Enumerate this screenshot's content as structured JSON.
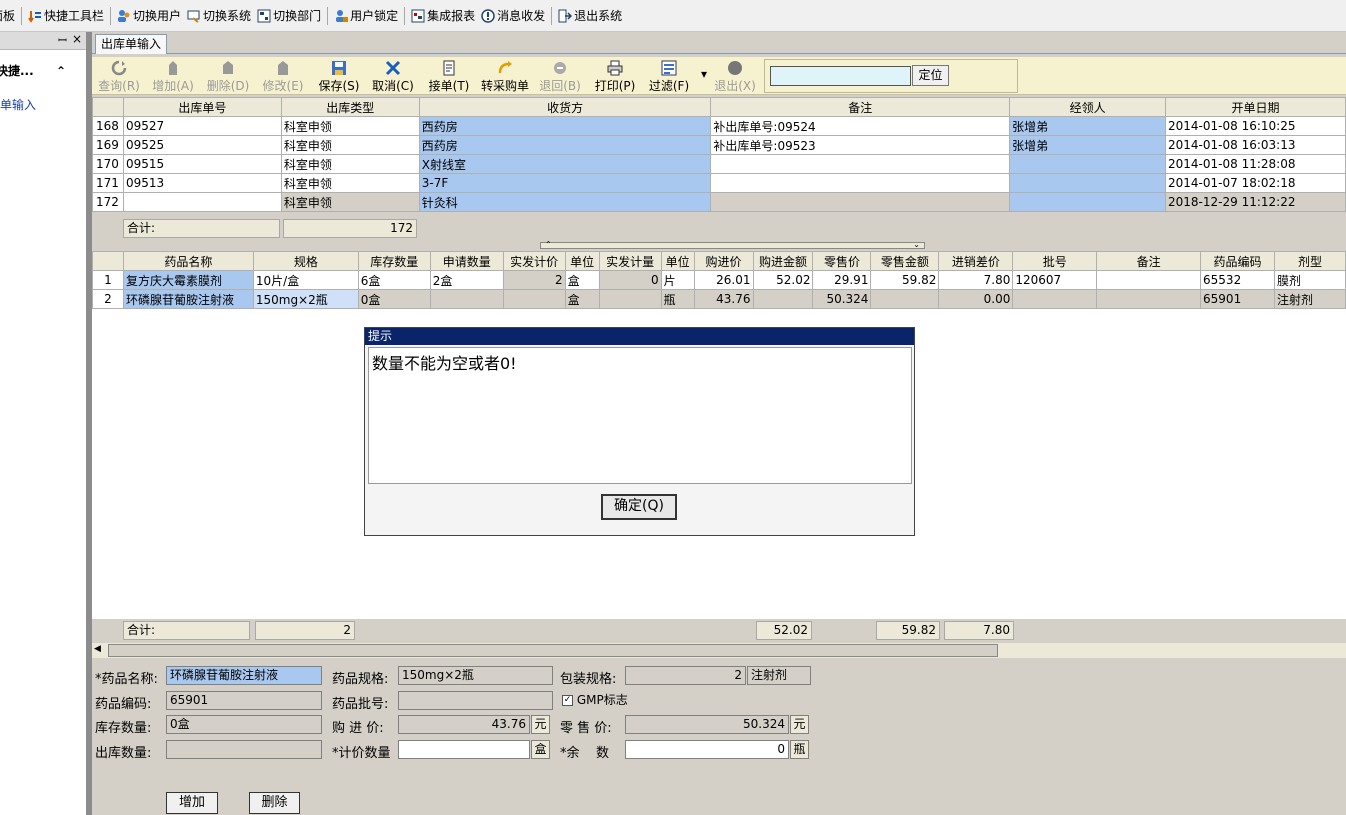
{
  "topbar": {
    "items": [
      {
        "label": "面板",
        "icon": "panel-icon"
      },
      {
        "label": "快捷工具栏",
        "icon": "quick-toolbar-icon"
      },
      {
        "label": "切换用户",
        "icon": "switch-user-icon"
      },
      {
        "label": "切换系统",
        "icon": "switch-system-icon"
      },
      {
        "label": "切换部门",
        "icon": "switch-dept-icon"
      },
      {
        "label": "用户锁定",
        "icon": "user-lock-icon"
      },
      {
        "label": "集成报表",
        "icon": "report-icon"
      },
      {
        "label": "消息收发",
        "icon": "message-icon"
      },
      {
        "label": "退出系统",
        "icon": "exit-system-icon"
      }
    ]
  },
  "leftpanel": {
    "pin": "ꟷ",
    "close": "×",
    "group_label": "快捷...",
    "group_caret": "⌃",
    "link": "出库单输入"
  },
  "tab": {
    "label": "出库单输入"
  },
  "toolbar": {
    "buttons": [
      {
        "label": "查询(R)",
        "enabled": false,
        "icon": "refresh-icon"
      },
      {
        "label": "增加(A)",
        "enabled": false,
        "icon": "add-icon"
      },
      {
        "label": "删除(D)",
        "enabled": false,
        "icon": "delete-icon"
      },
      {
        "label": "修改(E)",
        "enabled": false,
        "icon": "edit-icon"
      },
      {
        "label": "保存(S)",
        "enabled": true,
        "icon": "save-icon"
      },
      {
        "label": "取消(C)",
        "enabled": true,
        "icon": "cancel-icon"
      },
      {
        "label": "接单(T)",
        "enabled": true,
        "icon": "receive-order-icon"
      },
      {
        "label": "转采购单",
        "enabled": true,
        "icon": "convert-purchase-icon"
      },
      {
        "label": "退回(B)",
        "enabled": false,
        "icon": "return-icon"
      },
      {
        "label": "打印(P)",
        "enabled": true,
        "icon": "print-icon"
      },
      {
        "label": "过滤(F)",
        "enabled": true,
        "icon": "filter-icon"
      },
      {
        "label": "退出(X)",
        "enabled": false,
        "icon": "exit-icon"
      }
    ],
    "filter_arrow": "▾",
    "locate_value": "",
    "locate_button": "定位"
  },
  "grid1": {
    "headers": [
      "",
      "出库单号",
      "出库类型",
      "收货方",
      "备注",
      "经领人",
      "开单日期"
    ],
    "rows": [
      [
        "168",
        "09527",
        "科室申领",
        "西药房",
        "补出库单号:09524",
        "张增弟",
        "2014-01-08 16:10:25"
      ],
      [
        "169",
        "09525",
        "科室申领",
        "西药房",
        "补出库单号:09523",
        "张增弟",
        "2014-01-08 16:03:13"
      ],
      [
        "170",
        "09515",
        "科室申领",
        "X射线室",
        "",
        "",
        "2014-01-08 11:28:08"
      ],
      [
        "171",
        "09513",
        "科室申领",
        "3-7F",
        "",
        "",
        "2014-01-07 18:02:18"
      ],
      [
        "172",
        "",
        "科室申领",
        "针灸科",
        "",
        "",
        "2018-12-29 11:12:22"
      ]
    ],
    "sum_label": "合计:",
    "sum_count": "172"
  },
  "divider": {
    "up": "⌃",
    "down": "⌄"
  },
  "grid2": {
    "headers": [
      "",
      "药品名称",
      "规格",
      "库存数量",
      "申请数量",
      "实发计价",
      "单位",
      "实发计量",
      "单位",
      "购进价",
      "购进金额",
      "零售价",
      "零售金额",
      "进销差价",
      "批号",
      "备注",
      "药品编码",
      "剂型"
    ],
    "rows": [
      [
        "1",
        "复方庆大霉素膜剂",
        "10片/盒",
        "6盒",
        "2盒",
        "2",
        "盒",
        "0",
        "片",
        "26.01",
        "52.02",
        "29.91",
        "59.82",
        "7.80",
        "120607",
        "",
        "65532",
        "膜剂"
      ],
      [
        "2",
        "环磷腺苷葡胺注射液",
        "150mg×2瓶",
        "0盒",
        "",
        "",
        "盒",
        "",
        "瓶",
        "43.76",
        "",
        "50.324",
        "",
        "0.00",
        "",
        "",
        "65901",
        "注射剂"
      ]
    ],
    "sum_label": "合计:",
    "sum_count": "2",
    "sum_purchase": "52.02",
    "sum_retail": "59.82",
    "sum_diff": "7.80"
  },
  "form": {
    "drug_name_label": "*药品名称:",
    "drug_name": "环磷腺苷葡胺注射液",
    "spec_label": "药品规格:",
    "spec": "150mg×2瓶",
    "pack_label": "包装规格:",
    "pack_qty": "2",
    "pack_form": "注射剂",
    "code_label": "药品编码:",
    "code": "65901",
    "batch_label": "药品批号:",
    "batch": "",
    "gmp_label": "GMP标志",
    "stock_label": "库存数量:",
    "stock": "0盒",
    "buy_label": "购 进 价:",
    "buy_price": "43.76",
    "buy_unit": "元",
    "retail_label": "零 售 价:",
    "retail_price": "50.324",
    "retail_unit": "元",
    "out_qty_label": "出库数量:",
    "out_qty": "",
    "price_qty_label": "*计价数量",
    "price_qty": "",
    "price_qty_unit": "盒",
    "remain_label": "*余    数",
    "remain": "0",
    "remain_unit": "瓶",
    "add_button": "增加",
    "delete_button": "删除"
  },
  "dialog": {
    "title": "提示",
    "message": "数量不能为空或者0!",
    "ok_button": "确定(Q)"
  },
  "colors": {
    "selection_blue": "#a8c8f0",
    "toolbar_bg": "#f6f2cf",
    "title_bar": "#0a246a"
  }
}
